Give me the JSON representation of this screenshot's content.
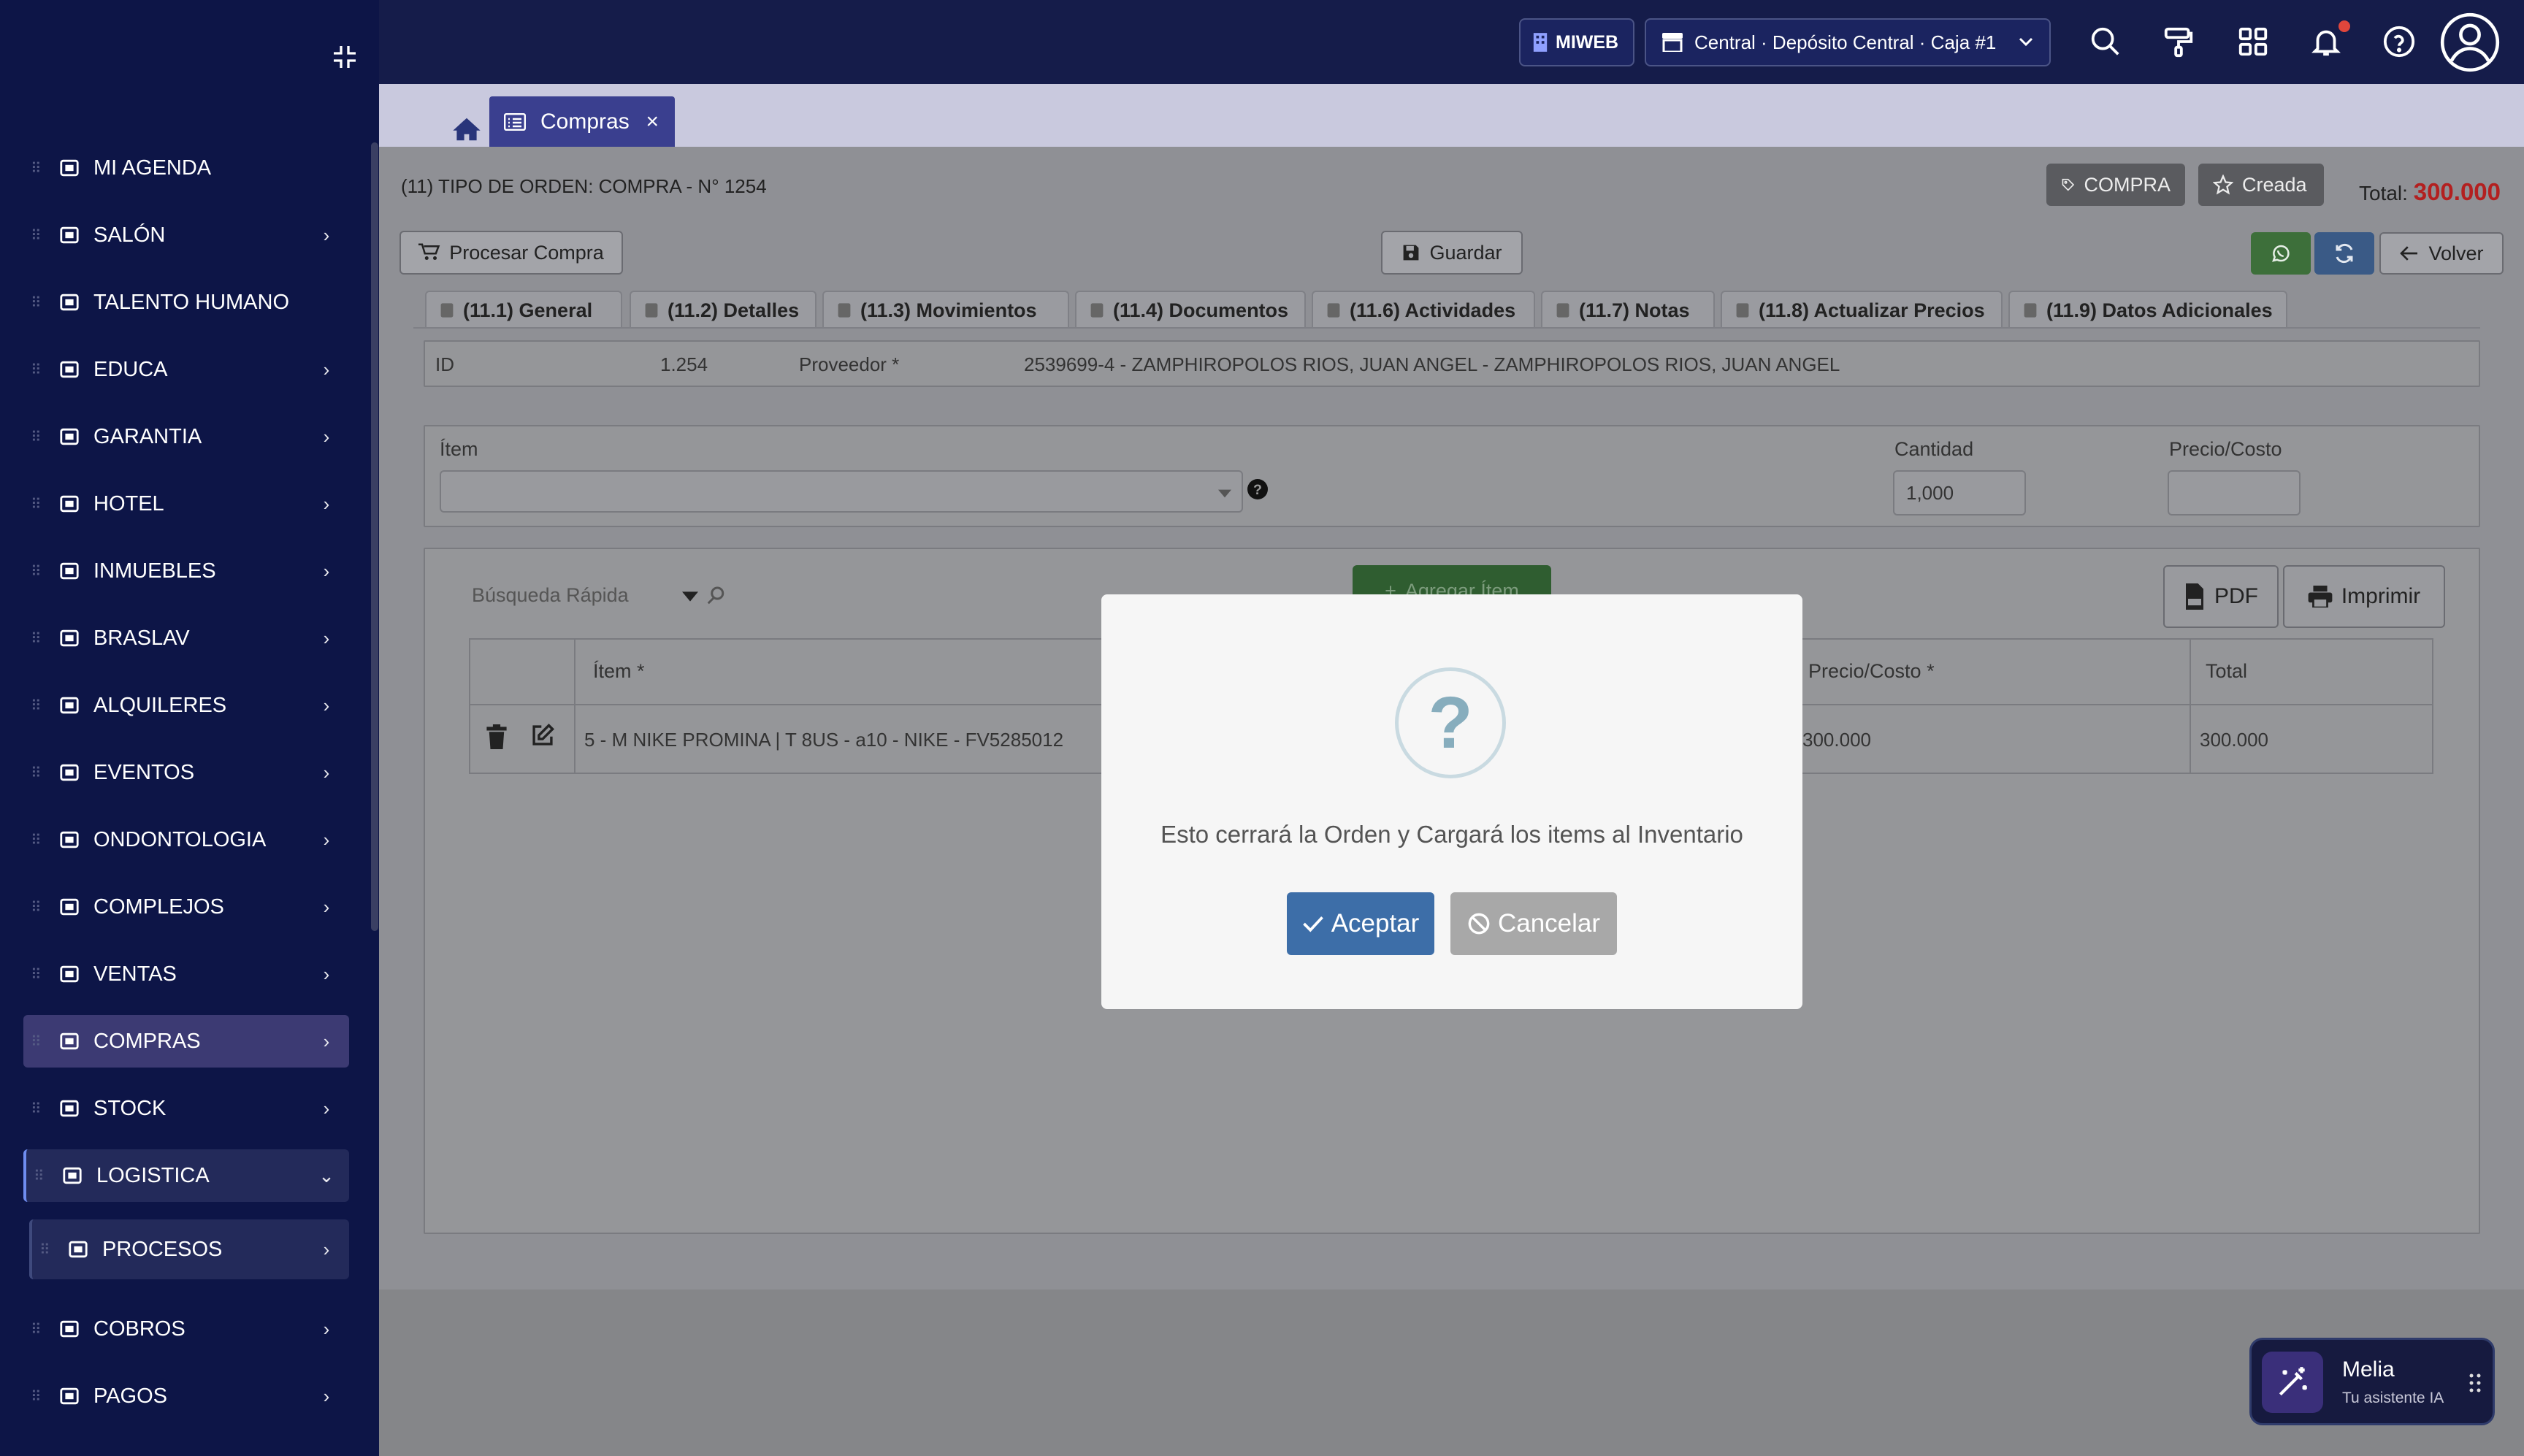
{
  "sidebar": {
    "items": [
      {
        "label": "MI AGENDA",
        "icon": "agenda-icon",
        "chev": ""
      },
      {
        "label": "SALÓN",
        "icon": "hand-icon",
        "chev": "›"
      },
      {
        "label": "TALENTO HUMANO",
        "icon": "people-icon",
        "chev": ""
      },
      {
        "label": "EDUCA",
        "icon": "teacher-icon",
        "chev": "›"
      },
      {
        "label": "GARANTIA",
        "icon": "award-icon",
        "chev": "›"
      },
      {
        "label": "HOTEL",
        "icon": "hotel-icon",
        "chev": "›"
      },
      {
        "label": "INMUEBLES",
        "icon": "house-icon",
        "chev": "›"
      },
      {
        "label": "BRASLAV",
        "icon": "building-user-icon",
        "chev": "›"
      },
      {
        "label": "ALQUILERES",
        "icon": "store-icon",
        "chev": "›"
      },
      {
        "label": "EVENTOS",
        "icon": "cake-icon",
        "chev": "›"
      },
      {
        "label": "ONDONTOLOGIA",
        "icon": "tooth-icon",
        "chev": "›"
      },
      {
        "label": "COMPLEJOS",
        "icon": "users-gear-icon",
        "chev": "›"
      },
      {
        "label": "VENTAS",
        "icon": "cart-icon",
        "chev": "›"
      },
      {
        "label": "COMPRAS",
        "icon": "basket-icon",
        "chev": "›"
      },
      {
        "label": "STOCK",
        "icon": "barcode-icon",
        "chev": "›"
      },
      {
        "label": "LOGISTICA",
        "icon": "truck-icon",
        "chev": "⌄"
      },
      {
        "label": "PROCESOS",
        "icon": "gear-icon",
        "chev": "›"
      },
      {
        "label": "COBROS",
        "icon": "credit-card-icon",
        "chev": "›"
      },
      {
        "label": "PAGOS",
        "icon": "money-icon",
        "chev": "›"
      }
    ]
  },
  "topbar": {
    "miweb": "MIWEB",
    "location": "Central · Depósito Central · Caja #1"
  },
  "tabs": {
    "active": "Compras",
    "close": "×"
  },
  "order": {
    "title": "(11) TIPO DE ORDEN: COMPRA - N° 1254",
    "badge_type": "COMPRA",
    "badge_status": "Creada",
    "total_label": "Total:",
    "total_value": "300.000"
  },
  "actions": {
    "procesar": "Procesar Compra",
    "guardar": "Guardar",
    "volver": "Volver"
  },
  "panel_tabs": [
    "(11.1) General",
    "(11.2) Detalles",
    "(11.3) Movimientos",
    "(11.4) Documentos",
    "(11.6) Actividades",
    "(11.7) Notas",
    "(11.8) Actualizar Precios",
    "(11.9) Datos Adicionales"
  ],
  "info": {
    "id_label": "ID",
    "id_value": "1.254",
    "prov_label": "Proveedor *",
    "prov_value": "2539699-4 - ZAMPHIROPOLOS RIOS, JUAN ANGEL - ZAMPHIROPOLOS RIOS, JUAN ANGEL"
  },
  "form": {
    "item_label": "Ítem",
    "qty_label": "Cantidad",
    "qty_value": "1,000",
    "price_label": "Precio/Costo"
  },
  "list": {
    "search_placeholder": "Búsqueda Rápida",
    "add_button": "Agregar Ítem",
    "pdf": "PDF",
    "print": "Imprimir",
    "headers": {
      "item": "Ítem *",
      "price": "Precio/Costo *",
      "total": "Total"
    },
    "rows": [
      {
        "item": "5 - M NIKE PROMINA | T 8US - a10 - NIKE - FV5285012",
        "price": "300.000",
        "total": "300.000"
      }
    ]
  },
  "modal": {
    "message": "Esto cerrará la Orden y Cargará los items al Inventario",
    "accept": "Aceptar",
    "cancel": "Cancelar",
    "question": "?"
  },
  "assistant": {
    "name": "Melia",
    "subtitle": "Tu asistente IA"
  },
  "colors": {
    "sidebar": "#0d1547",
    "accent": "#3a3f8f",
    "total_red": "#b32020",
    "accept": "#3d6ea8",
    "cancel": "#a8a8a8"
  }
}
